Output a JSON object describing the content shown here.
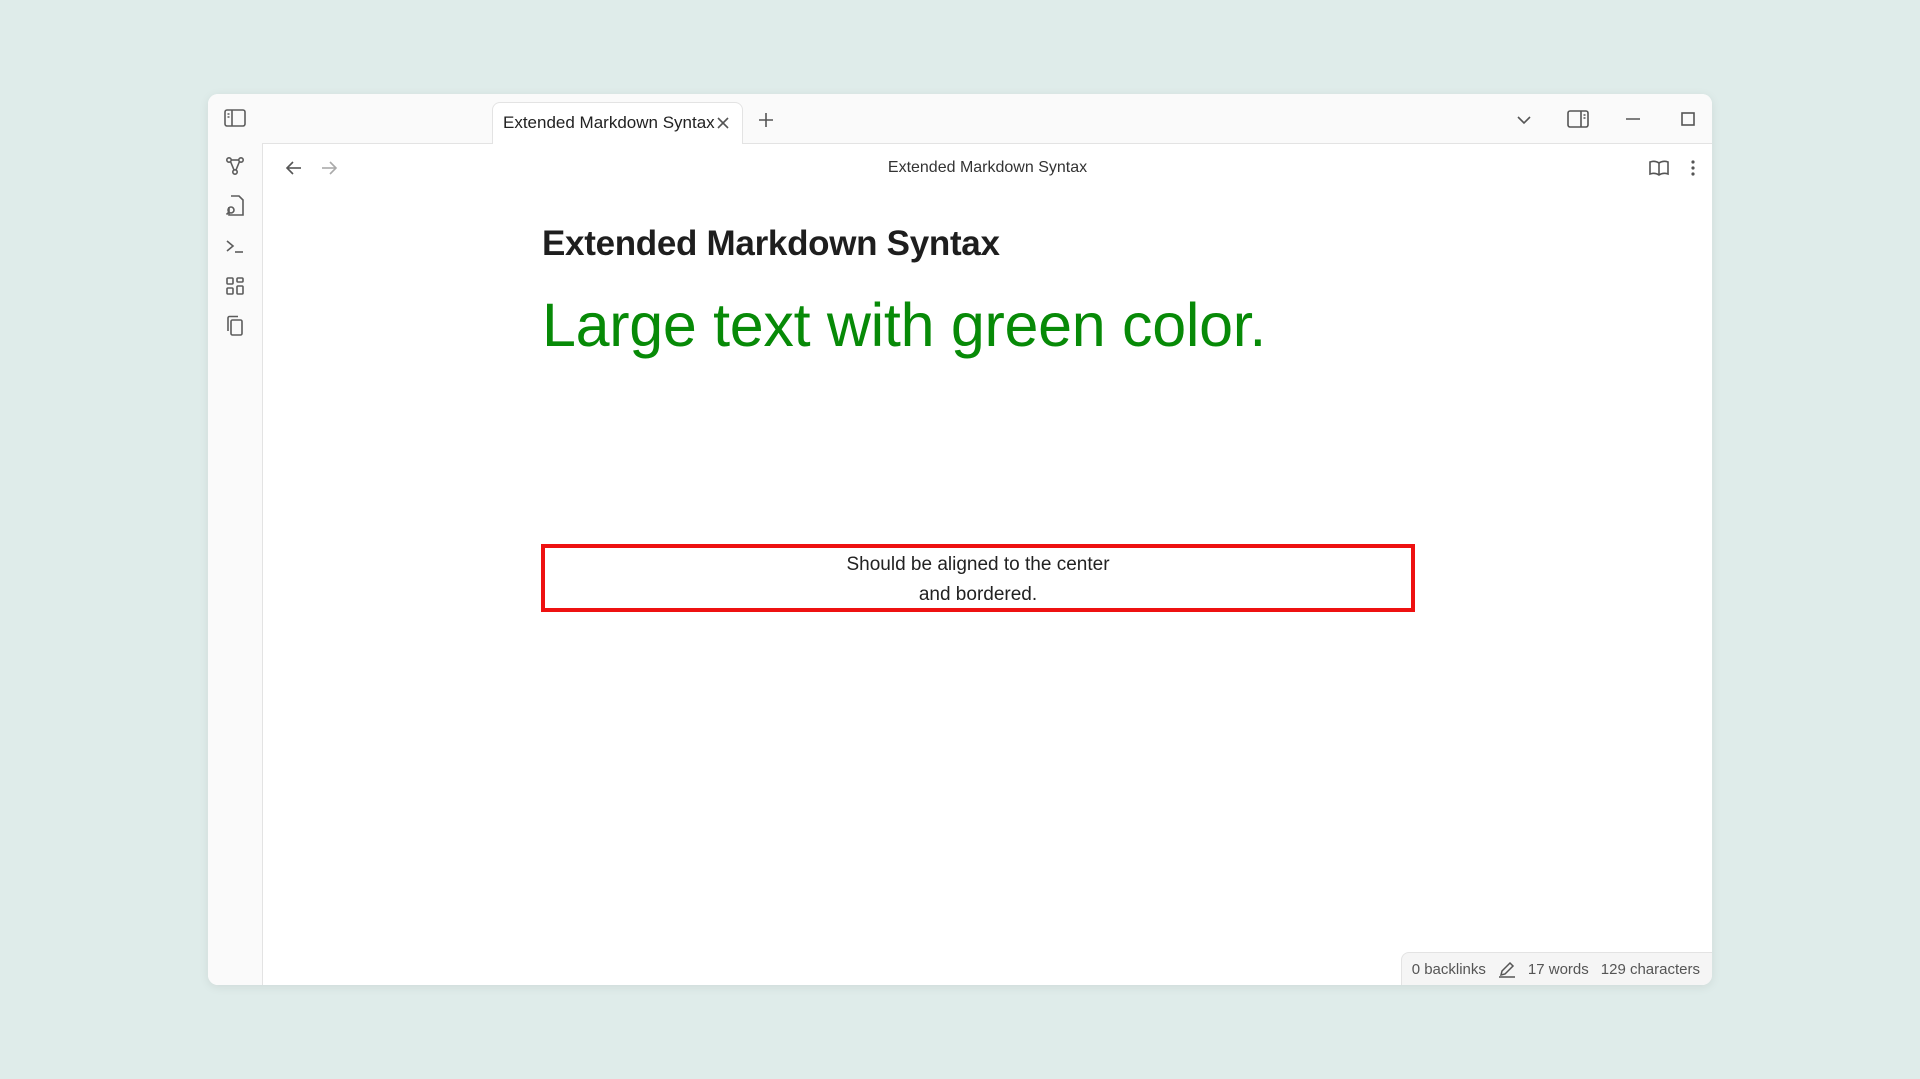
{
  "tab": {
    "title": "Extended Markdown Syntax",
    "new_tab_symbol": "+"
  },
  "header": {
    "title": "Extended Markdown Syntax"
  },
  "document": {
    "heading": "Extended Markdown Syntax",
    "large_text": "Large text with green color.",
    "large_text_color": "#078a07",
    "box_line_1": "Should be aligned to the center",
    "box_line_2": "and bordered.",
    "box_border_color": "#ee1111"
  },
  "status_bar": {
    "backlinks": "0 backlinks",
    "words": "17 words",
    "characters": "129 characters"
  },
  "icons": {
    "ribbon": [
      "sidebar-toggle-icon",
      "graph-icon",
      "file-search-icon",
      "terminal-icon",
      "dashboard-icon",
      "copy-icon"
    ],
    "titlebar": [
      "chevron-down-icon",
      "split-view-icon",
      "minimize-icon",
      "maximize-icon",
      "close-icon"
    ],
    "header": [
      "back-arrow-icon",
      "forward-arrow-icon",
      "reading-mode-icon",
      "more-options-icon"
    ]
  }
}
